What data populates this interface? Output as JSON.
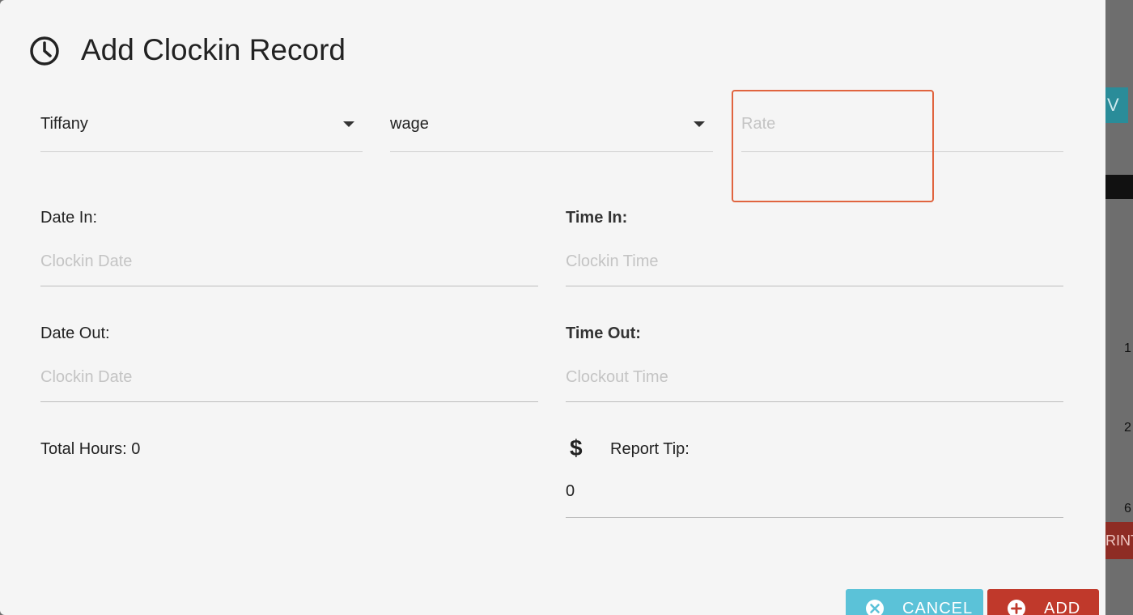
{
  "dialog": {
    "title": "Add Clockin Record",
    "icon": "clock-icon"
  },
  "employee_select": {
    "value": "Tiffany"
  },
  "pay_type_select": {
    "value": "wage"
  },
  "rate": {
    "placeholder": "Rate",
    "value": ""
  },
  "date_in": {
    "label": "Date In:",
    "placeholder": "Clockin Date"
  },
  "time_in": {
    "label": "Time In:",
    "placeholder": "Clockin Time"
  },
  "date_out": {
    "label": "Date Out:",
    "placeholder": "Clockin Date"
  },
  "time_out": {
    "label": "Time Out:",
    "placeholder": "Clockout Time"
  },
  "total_hours": {
    "text": "Total Hours: 0"
  },
  "report_tip": {
    "label": "Report Tip:",
    "icon": "$",
    "value": "0"
  },
  "buttons": {
    "cancel": "CANCEL",
    "add": "ADD"
  },
  "background": {
    "teal_fragment": "V",
    "numbers": [
      "1",
      "2",
      "6"
    ],
    "red_fragment": "RINT"
  },
  "colors": {
    "dialog_bg": "#f5f5f5",
    "cancel_button": "#5bc2d8",
    "add_button": "#c0392b",
    "highlight_border": "#e0643f"
  }
}
